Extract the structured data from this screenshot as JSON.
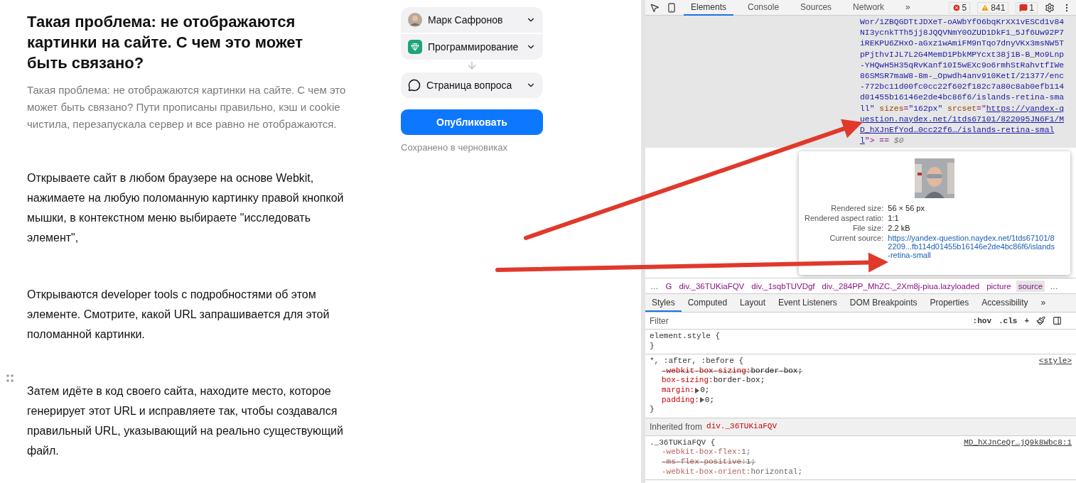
{
  "article": {
    "title": "Такая проблема: не отображаются картинки на сайте. С чем это может быть связано?",
    "description": "Такая проблема: не отображаются картинки на сайте. С чем это может быть связано? Пути прописаны правильно, кэш и cookie чистила, перезапускала сервер и все равно не отображаются.",
    "paragraphs": [
      "Открываете сайт в любом браузере на основе Webkit, нажимаете на любую поломанную картинку правой кнопкой мышки, в контекстном меню выбираете \"исследовать элемент\",",
      "Открываются developer tools с подробностями об этом элементе. Смотрите, какой URL запрашивается для этой поломанной картинки.",
      "Затем идёте в код своего сайта, находите место, которое генерирует этот URL и исправляете так, чтобы создавался правильный URL, указывающий на реально существующий файл."
    ]
  },
  "publish_panel": {
    "author": "Марк Сафронов",
    "category": "Программирование",
    "destination": "Страница вопроса",
    "publish_button": "Опубликовать",
    "status": "Сохранено в черновиках"
  },
  "devtools": {
    "tabs": [
      {
        "label": "Elements",
        "selected": true
      },
      {
        "label": "Console",
        "selected": false
      },
      {
        "label": "Sources",
        "selected": false
      },
      {
        "label": "Network",
        "selected": false
      }
    ],
    "more_tabs": "»",
    "counters": [
      {
        "kind": "error",
        "count": "5"
      },
      {
        "kind": "warning",
        "count": "841"
      },
      {
        "kind": "issue",
        "count": "1"
      }
    ],
    "code_lines": [
      [
        {
          "kind": "value",
          "text": "Wor/1ZBQGDTtJDXeT-oAWbYfO6bqKrXX1vESCd1v84"
        }
      ],
      [
        {
          "kind": "value",
          "text": "NI3ycnkTTh5jj8JQQVNmY0OZUD1DkF1_5Jf6Uw92P7"
        }
      ],
      [
        {
          "kind": "value",
          "text": "iREKPU6ZHxO-aGxz1wAmiFM9nTqo7dnyVKx3msNW5T"
        }
      ],
      [
        {
          "kind": "value",
          "text": "pPjthvIJL7L2G4MemD1PbkMPYcxt38j1B-B_Mo9Lnp"
        }
      ],
      [
        {
          "kind": "value",
          "text": "-YHQwH5H35qRvKanf10I5wEXc9o6rmhStRahvtfIWe"
        }
      ],
      [
        {
          "kind": "value",
          "text": "86SMSR7maW8-8m-_Opwdh4anv910KetI/21377/enc"
        }
      ],
      [
        {
          "kind": "value",
          "text": "-772bc11d00fc0cc22f602f182c7a80c8ab0efb114"
        }
      ],
      [
        {
          "kind": "value",
          "text": "d01455b16146e2de4bc86f6/islands-retina-sma"
        }
      ],
      [
        {
          "kind": "value",
          "text": "ll\""
        },
        {
          "kind": "attr",
          "text": " sizes"
        },
        {
          "kind": "plain",
          "text": "="
        },
        {
          "kind": "value",
          "text": "\"162px\""
        },
        {
          "kind": "attr",
          "text": " srcset"
        },
        {
          "kind": "plain",
          "text": "=\""
        },
        {
          "kind": "link",
          "text": "https://yandex-q"
        }
      ],
      [
        {
          "kind": "link",
          "text": "uestion.naydex.net/1tds67101/822095JN6F1/M"
        }
      ],
      [
        {
          "kind": "link",
          "text": "D_hXJnEfYod…0cc22f6…/islands-retina-smal"
        }
      ],
      [
        {
          "kind": "link",
          "text": "l"
        },
        {
          "kind": "plain",
          "text": "\"> == "
        },
        {
          "kind": "dim",
          "text": "$0"
        }
      ]
    ],
    "tooltip": {
      "rows": [
        {
          "kind": "text",
          "label": "Rendered size:",
          "value": "56 × 56 px"
        },
        {
          "kind": "text",
          "label": "Rendered aspect ratio:",
          "value": "1:1"
        },
        {
          "kind": "text",
          "label": "File size:",
          "value": "2.2 kB"
        },
        {
          "kind": "link",
          "label": "Current source:",
          "value": "https://yandex-question.naydex.net/1tds67101/82209...fb114d01455b16146e2de4bc86f6/islands-retina-small"
        }
      ]
    },
    "breadcrumbs": [
      {
        "kind": "ellipsis",
        "text": "…",
        "selected": false
      },
      {
        "kind": "node",
        "text": "G",
        "selected": false
      },
      {
        "kind": "node",
        "text": "div._36TUKiaFQV",
        "selected": false
      },
      {
        "kind": "node",
        "text": "div._1sqbTUVDgf",
        "selected": false
      },
      {
        "kind": "node",
        "text": "div._284PP_MhZC._2Xm8j-piua.lazyloaded",
        "selected": false
      },
      {
        "kind": "node",
        "text": "picture",
        "selected": false
      },
      {
        "kind": "node",
        "text": "source",
        "selected": true
      },
      {
        "kind": "ellipsis",
        "text": "…",
        "selected": false
      }
    ],
    "panel_tabs": [
      {
        "label": "Styles",
        "selected": true
      },
      {
        "label": "Computed",
        "selected": false
      },
      {
        "label": "Layout",
        "selected": false
      },
      {
        "label": "Event Listeners",
        "selected": false
      },
      {
        "label": "DOM Breakpoints",
        "selected": false
      },
      {
        "label": "Properties",
        "selected": false
      },
      {
        "label": "Accessibility",
        "selected": false
      }
    ],
    "more_panel_tabs": "»",
    "filter": {
      "placeholder": "Filter"
    },
    "filter_tools": [
      ":hov",
      ".cls",
      "+"
    ],
    "rules": [
      {
        "kind": "rule",
        "selector": "element.style {",
        "close": "}"
      },
      {
        "kind": "rule",
        "selector": "*, :after, :before {",
        "source": "<style>",
        "close": "}",
        "props": [
          {
            "name": "-webkit-box-sizing:",
            "value": "border-box;",
            "struck": true,
            "dim": false,
            "expandable": false
          },
          {
            "name": "box-sizing:",
            "value": "border-box;",
            "struck": false,
            "dim": false,
            "expandable": false
          },
          {
            "name": "margin:",
            "value": "0;",
            "struck": false,
            "dim": false,
            "expandable": true
          },
          {
            "name": "padding:",
            "value": "0;",
            "struck": false,
            "dim": false,
            "expandable": true
          }
        ]
      },
      {
        "kind": "inherited",
        "label": "Inherited from",
        "node": "div._36TUKiaFQV"
      },
      {
        "kind": "rule",
        "selector": "._36TUKiaFQV {",
        "source": "MD_hXJnCeQr…jQ9k8Wbc8:1",
        "props": [
          {
            "name": "-webkit-box-flex:",
            "value": "1;",
            "struck": false,
            "dim": true,
            "expandable": false
          },
          {
            "name": "-ms-flex-positive:",
            "value": "1;",
            "struck": true,
            "dim": true,
            "expandable": false
          },
          {
            "name": "-webkit-box-orient:",
            "value": "horizontal;",
            "struck": false,
            "dim": true,
            "expandable": false
          }
        ]
      }
    ]
  }
}
